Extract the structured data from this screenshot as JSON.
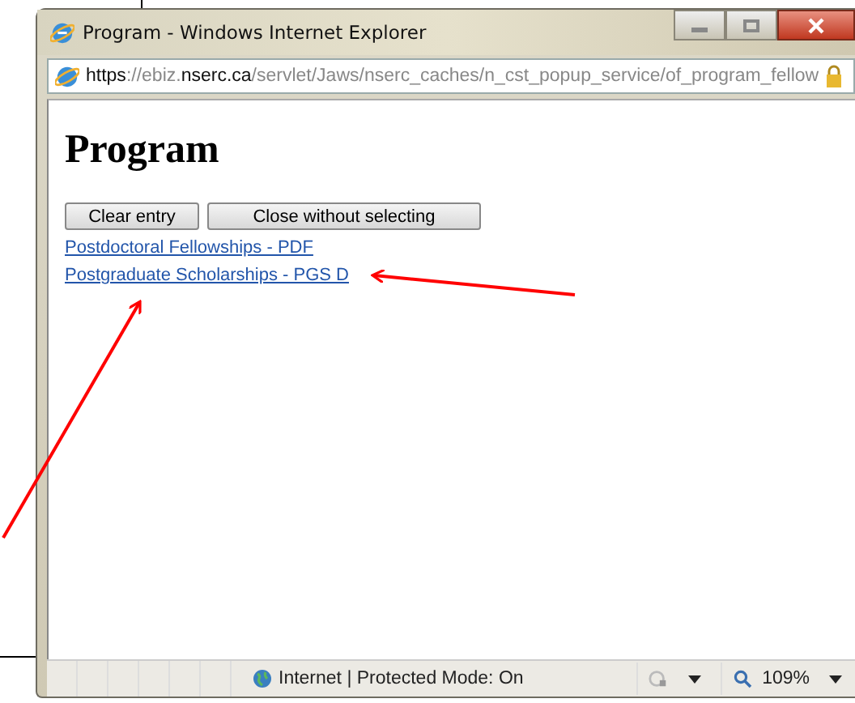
{
  "window": {
    "title": "Program - Windows Internet Explorer"
  },
  "address_bar": {
    "segments": [
      {
        "text": "https",
        "dim": false
      },
      {
        "text": "://ebiz.",
        "dim": true
      },
      {
        "text": "nserc.ca",
        "dim": false
      },
      {
        "text": "/servlet/Jaws/nserc_caches/n_cst_popup_service/of_program_fellow",
        "dim": true
      }
    ]
  },
  "page": {
    "heading": "Program",
    "buttons": [
      "Clear entry",
      "Close without selecting"
    ],
    "links": [
      "Postdoctoral Fellowships - PDF",
      "Postgraduate Scholarships - PGS D"
    ]
  },
  "status_bar": {
    "zone": "Internet | Protected Mode: On",
    "zoom": "109%"
  }
}
